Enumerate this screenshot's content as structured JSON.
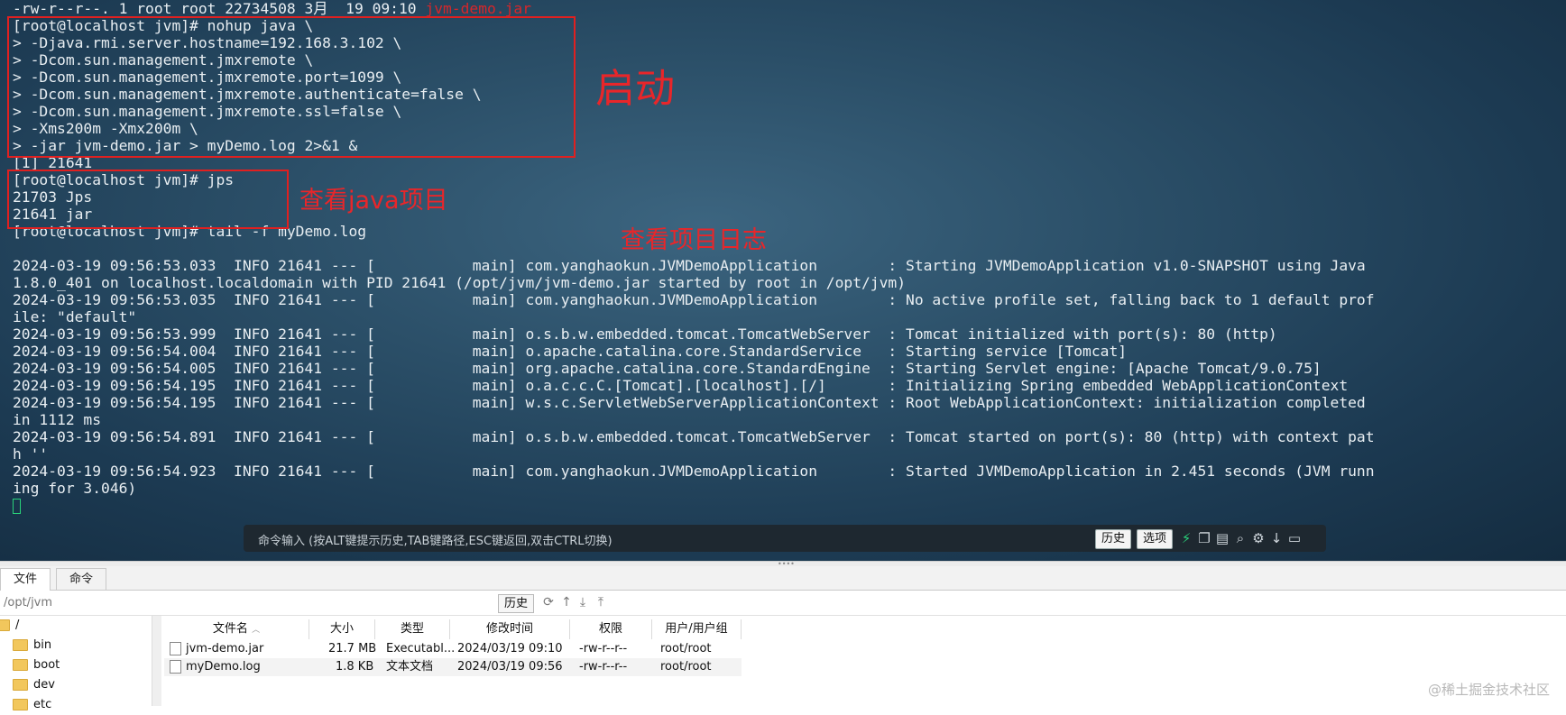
{
  "terminal": {
    "lines": [
      {
        "text": "-rw-r--r--. 1 root root 22734508 3月  19 09:10 ",
        "highlight": "jvm-demo.jar"
      },
      {
        "text": "[root@localhost jvm]# nohup java \\"
      },
      {
        "text": "> -Djava.rmi.server.hostname=192.168.3.102 \\"
      },
      {
        "text": "> -Dcom.sun.management.jmxremote \\"
      },
      {
        "text": "> -Dcom.sun.management.jmxremote.port=1099 \\"
      },
      {
        "text": "> -Dcom.sun.management.jmxremote.authenticate=false \\"
      },
      {
        "text": "> -Dcom.sun.management.jmxremote.ssl=false \\"
      },
      {
        "text": "> -Xms200m -Xmx200m \\"
      },
      {
        "text": "> -jar jvm-demo.jar > myDemo.log 2>&1 &"
      },
      {
        "text": "[1] 21641"
      },
      {
        "text": "[root@localhost jvm]# jps"
      },
      {
        "text": "21703 Jps"
      },
      {
        "text": "21641 jar"
      },
      {
        "text": "[root@localhost jvm]# tail -f myDemo.log"
      },
      {
        "text": ""
      },
      {
        "text": "2024-03-19 09:56:53.033  INFO 21641 --- [           main] com.yanghaokun.JVMDemoApplication        : Starting JVMDemoApplication v1.0-SNAPSHOT using Java"
      },
      {
        "text": "1.8.0_401 on localhost.localdomain with PID 21641 (/opt/jvm/jvm-demo.jar started by root in /opt/jvm)"
      },
      {
        "text": "2024-03-19 09:56:53.035  INFO 21641 --- [           main] com.yanghaokun.JVMDemoApplication        : No active profile set, falling back to 1 default prof"
      },
      {
        "text": "ile: \"default\""
      },
      {
        "text": "2024-03-19 09:56:53.999  INFO 21641 --- [           main] o.s.b.w.embedded.tomcat.TomcatWebServer  : Tomcat initialized with port(s): 80 (http)"
      },
      {
        "text": "2024-03-19 09:56:54.004  INFO 21641 --- [           main] o.apache.catalina.core.StandardService   : Starting service [Tomcat]"
      },
      {
        "text": "2024-03-19 09:56:54.005  INFO 21641 --- [           main] org.apache.catalina.core.StandardEngine  : Starting Servlet engine: [Apache Tomcat/9.0.75]"
      },
      {
        "text": "2024-03-19 09:56:54.195  INFO 21641 --- [           main] o.a.c.c.C.[Tomcat].[localhost].[/]       : Initializing Spring embedded WebApplicationContext"
      },
      {
        "text": "2024-03-19 09:56:54.195  INFO 21641 --- [           main] w.s.c.ServletWebServerApplicationContext : Root WebApplicationContext: initialization completed"
      },
      {
        "text": "in 1112 ms"
      },
      {
        "text": "2024-03-19 09:56:54.891  INFO 21641 --- [           main] o.s.b.w.embedded.tomcat.TomcatWebServer  : Tomcat started on port(s): 80 (http) with context pat"
      },
      {
        "text": "h ''"
      },
      {
        "text": "2024-03-19 09:56:54.923  INFO 21641 --- [           main] com.yanghaokun.JVMDemoApplication        : Started JVMDemoApplication in 2.451 seconds (JVM runn"
      },
      {
        "text": "ing for 3.046)"
      }
    ],
    "annotations": {
      "start": "启动",
      "check_java": "查看java项目",
      "check_log": "查看项目日志"
    },
    "command_bar": {
      "placeholder": "命令输入 (按ALT键提示历史,TAB键路径,ESC键返回,双击CTRL切换)",
      "history_button": "历史",
      "options_button": "选项"
    }
  },
  "tabs": [
    "文件",
    "命令"
  ],
  "path_bar": {
    "path": "/opt/jvm",
    "history_button": "历史"
  },
  "tree": [
    {
      "name": "/"
    },
    {
      "name": "bin"
    },
    {
      "name": "boot"
    },
    {
      "name": "dev"
    },
    {
      "name": "etc"
    }
  ],
  "file_list": {
    "columns": [
      "文件名",
      "大小",
      "类型",
      "修改时间",
      "权限",
      "用户/用户组"
    ],
    "rows": [
      {
        "name": "jvm-demo.jar",
        "size": "21.7 MB",
        "type": "Executabl...",
        "modified": "2024/03/19 09:10",
        "perm": "-rw-r--r--",
        "owner": "root/root"
      },
      {
        "name": "myDemo.log",
        "size": "1.8 KB",
        "type": "文本文档",
        "modified": "2024/03/19 09:56",
        "perm": "-rw-r--r--",
        "owner": "root/root"
      }
    ]
  },
  "watermark": "@稀土掘金技术社区",
  "colors": {
    "annotation_red": "#e8262a",
    "cursor_green": "#29d27a",
    "terminal_bg": "#1c3a52"
  }
}
